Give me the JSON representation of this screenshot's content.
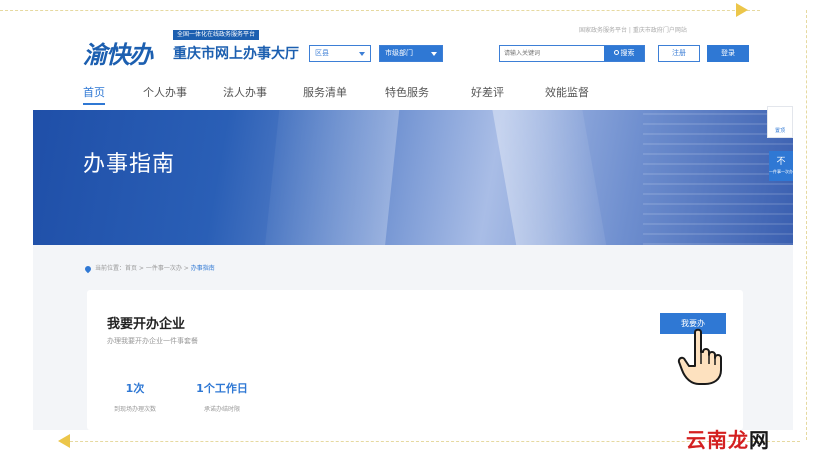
{
  "header": {
    "logo_mark": "渝快办",
    "logo_tag": "全国一体化在线政务服务平台",
    "logo_title": "重庆市网上办事大厅",
    "top_links": "国家政务服务平台 | 重庆市政府门户网站",
    "region_select": "区县",
    "dept_select": "市级部门",
    "search_placeholder": "请输入关键词",
    "search_button": "搜索",
    "register": "注册",
    "login": "登录"
  },
  "nav": [
    {
      "label": "首页",
      "active": true
    },
    {
      "label": "个人办事",
      "active": false
    },
    {
      "label": "法人办事",
      "active": false
    },
    {
      "label": "服务清单",
      "active": false
    },
    {
      "label": "特色服务",
      "active": false
    },
    {
      "label": "好差评",
      "active": false
    },
    {
      "label": "效能监督",
      "active": false
    }
  ],
  "banner": {
    "title": "办事指南"
  },
  "side": {
    "top_label": "置顶",
    "tab_char": "不",
    "tab_small": "一件事一次办"
  },
  "breadcrumb": {
    "prefix": "当前位置：首页 > 一件事一次办 > ",
    "current": "办事指南"
  },
  "card": {
    "title": "我要开办企业",
    "subtitle": "办理我要开办企业一件事套餐",
    "button": "我要办",
    "stats": [
      {
        "value": "1次",
        "label": "到现场办理次数"
      },
      {
        "value": "1个工作日",
        "label": "承诺办结时限"
      }
    ]
  },
  "watermark": {
    "main": "云南龙",
    "tail": "网"
  }
}
